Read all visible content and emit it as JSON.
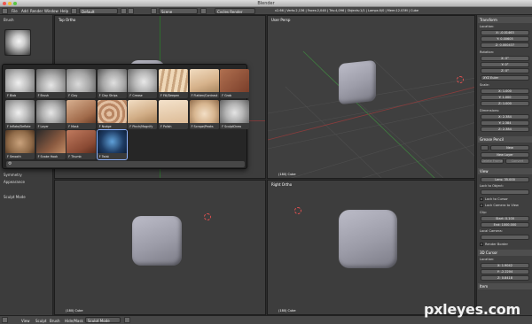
{
  "window": {
    "title": "Blender"
  },
  "info_header": {
    "menu": [
      "File",
      "Add",
      "Render",
      "Window",
      "Help"
    ],
    "screen": "Default",
    "scene": "Scene",
    "engine": "Cycles Render",
    "stats": "v2.66 | Verts:2,136 | Faces:2,048 | Tris:4,096 | Objects:1/1 | Lamps:0/0 | Mem:12.03M | Cube"
  },
  "tool_shelf": {
    "brush_panel": "Brush",
    "panels": [
      "Symmetry",
      "Appearance",
      "Sculpt Mode"
    ]
  },
  "brush_palette": {
    "brushes": [
      "F Blob",
      "F Brush",
      "F Clay",
      "F Clay Strips",
      "F Crease",
      "F Fill/Deepen",
      "F Flatten/Contrast",
      "F Grab",
      "F Inflate/Deflate",
      "F Layer",
      "F Mask",
      "F Nudge",
      "F Pinch/Magnify",
      "F Polish",
      "F Scrape/Peaks",
      "F SculptDraw",
      "F Smooth",
      "F Snake Hook",
      "F Thumb",
      "F Twist"
    ]
  },
  "viewports": {
    "top_ortho": {
      "label": "Top Ortho",
      "footer": "(180) Cube"
    },
    "user_persp": {
      "label": "User Persp",
      "footer": "(180) Cube"
    },
    "front_ortho": {
      "label": "",
      "footer": "(180) Cube"
    },
    "right_ortho": {
      "label": "Right Ortho",
      "footer": "(180) Cube"
    }
  },
  "properties": {
    "transform": "Transform",
    "location": "Location:",
    "loc": [
      "X: -0.01463",
      "Y: 0.00605",
      "Z: 0.000437"
    ],
    "rotation": "Rotation:",
    "rot": [
      "X: 0°",
      "Y: 0°",
      "Z: 0°"
    ],
    "rot_mode": "XYZ Euler",
    "scale": "Scale:",
    "scl": [
      "X: 1.000",
      "Y: 1.000",
      "Z: 1.000"
    ],
    "dimensions": "Dimensions:",
    "dim": [
      "X: 2.384",
      "Y: 2.384",
      "Z: 2.384"
    ],
    "grease": "Grease Pencil",
    "new": "New",
    "new_layer": "New Layer",
    "del_opts": [
      "Delete Frame",
      "Convert"
    ],
    "view": "View",
    "lens": "Lens: 35.000",
    "lock_obj": "Lock to Object:",
    "lock_cursor": "Lock to Cursor",
    "lock_cam": "Lock Camera to View",
    "clip": "Clip:",
    "clip_start": "Start: 0.100",
    "clip_end": "End: 1000.000",
    "local_camera": "Local Camera:",
    "render_border": "Render Border",
    "cursor_title": "3D Cursor",
    "cursor_loc": "Location:",
    "cur": [
      "X: 1.9042",
      "Y: -2.2204",
      "Z: 0.8418"
    ],
    "item": "Item"
  },
  "bottom_bar": {
    "items": [
      "View",
      "Sculpt",
      "Brush",
      "Hide/Mask"
    ],
    "mode": "Sculpt Mode"
  },
  "watermark": "pxleyes.com"
}
